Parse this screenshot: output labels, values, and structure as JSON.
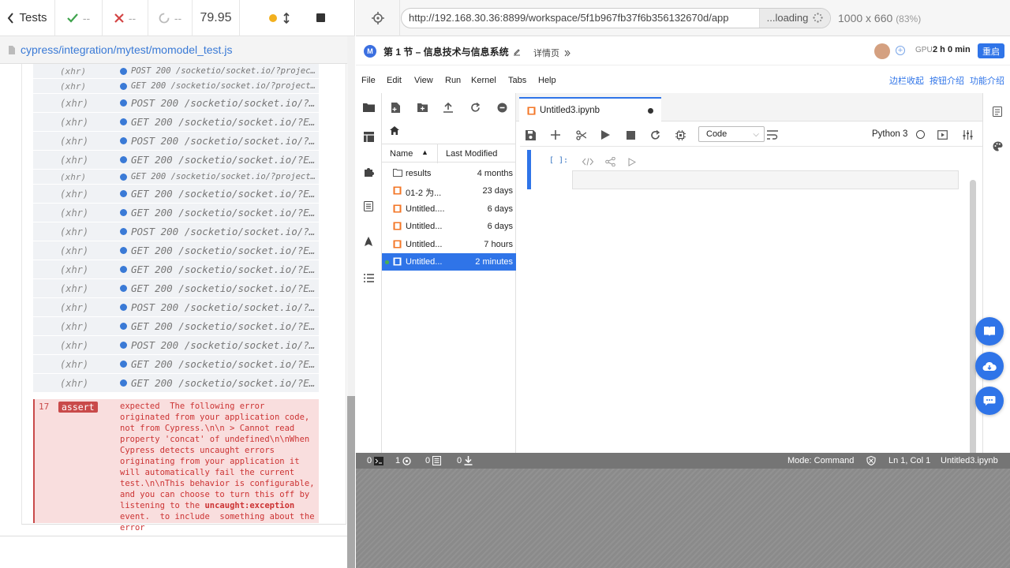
{
  "cypress": {
    "tests_label": "Tests",
    "passed": "--",
    "failed": "--",
    "pending": "--",
    "duration": "79.95",
    "spec_path": "cypress/integration/mytest/momodel_test.js",
    "commands": [
      {
        "kind": "(xhr)",
        "msg": "POST 200 /socketio/socket.io/?project...",
        "small": true
      },
      {
        "kind": "(xhr)",
        "msg": "GET 200 /socketio/socket.io/?project=...",
        "small": true
      },
      {
        "kind": "(xhr)",
        "msg": "POST 200 /socketio/socket.io/?EI...",
        "small": false
      },
      {
        "kind": "(xhr)",
        "msg": "GET 200 /socketio/socket.io/?EI...",
        "small": false
      },
      {
        "kind": "(xhr)",
        "msg": "POST 200 /socketio/socket.io/?EI...",
        "small": false
      },
      {
        "kind": "(xhr)",
        "msg": "GET 200 /socketio/socket.io/?EI...",
        "small": false
      },
      {
        "kind": "(xhr)",
        "msg": "GET 200 /socketio/socket.io/?project=...",
        "small": true
      },
      {
        "kind": "(xhr)",
        "msg": "GET 200 /socketio/socket.io/?EI...",
        "small": false
      },
      {
        "kind": "(xhr)",
        "msg": "GET 200 /socketio/socket.io/?EI...",
        "small": false
      },
      {
        "kind": "(xhr)",
        "msg": "POST 200 /socketio/socket.io/?E...",
        "small": false
      },
      {
        "kind": "(xhr)",
        "msg": "GET 200 /socketio/socket.io/?EI...",
        "small": false
      },
      {
        "kind": "(xhr)",
        "msg": "GET 200 /socketio/socket.io/?EI...",
        "small": false
      },
      {
        "kind": "(xhr)",
        "msg": "GET 200 /socketio/socket.io/?EI...",
        "small": false
      },
      {
        "kind": "(xhr)",
        "msg": "POST 200 /socketio/socket.io/?E...",
        "small": false
      },
      {
        "kind": "(xhr)",
        "msg": "GET 200 /socketio/socket.io/?EI...",
        "small": false
      },
      {
        "kind": "(xhr)",
        "msg": "POST 200 /socketio/socket.io/?E...",
        "small": false
      },
      {
        "kind": "(xhr)",
        "msg": "GET 200 /socketio/socket.io/?EI...",
        "small": false
      },
      {
        "kind": "(xhr)",
        "msg": "GET 200 /socketio/socket.io/?EI...",
        "small": false
      }
    ],
    "assert": {
      "number": "17",
      "badge": "assert",
      "message_pre": "expected  The following error originated from your application code, not from Cypress.\\n\\n > Cannot read property 'concat' of undefined\\n\\nWhen Cypress detects uncaught errors originating from your application it will automatically fail the current test.\\n\\nThis behavior is configurable, and you can choose to turn this off by listening to the ",
      "message_code": "uncaught:exception",
      "message_post": " event.  to include  something about the error"
    }
  },
  "aut": {
    "url": "http://192.168.30.36:8899/workspace/5f1b967fb37f6b356132670d/app",
    "loading": "...loading",
    "viewport": "1000 x 660",
    "scale": "(83%)"
  },
  "app": {
    "logo": "M",
    "title": "第 1 节 – 信息技术与信息系统",
    "details": "详情页",
    "gpu_label": "GPU",
    "gpu_time": "2 h 0 min",
    "restart": "重启",
    "menu": [
      "File",
      "Edit",
      "View",
      "Run",
      "Kernel",
      "Tabs",
      "Help"
    ],
    "right_links": [
      "边栏收起",
      "按钮介绍",
      "功能介绍"
    ],
    "file_browser": {
      "col_name": "Name",
      "col_modified": "Last Modified",
      "rows": [
        {
          "name": "results",
          "date": "4 months",
          "type": "folder",
          "selected": false
        },
        {
          "name": "01-2 为...",
          "date": "23 days",
          "type": "notebook",
          "selected": false
        },
        {
          "name": "Untitled....",
          "date": "6 days",
          "type": "notebook",
          "selected": false
        },
        {
          "name": "Untitled...",
          "date": "6 days",
          "type": "notebook",
          "selected": false
        },
        {
          "name": "Untitled...",
          "date": "7 hours",
          "type": "notebook",
          "selected": false
        },
        {
          "name": "Untitled...",
          "date": "2 minutes",
          "type": "notebook",
          "selected": true
        }
      ]
    },
    "notebook": {
      "tab_name": "Untitled3.ipynb",
      "cell_type": "Code",
      "kernel": "Python 3",
      "prompt": "[ ]:"
    },
    "status": {
      "terminals": "0",
      "kernels": "1",
      "docs": "0",
      "downloads": "0",
      "mode": "Mode: Command",
      "position": "Ln 1, Col 1",
      "file": "Untitled3.ipynb"
    }
  },
  "colors": {
    "accent": "#2f74e8",
    "cypress_link": "#3a7ad6",
    "error": "#c94a4a",
    "error_bg": "#f9dede",
    "status_bar": "#757575"
  }
}
